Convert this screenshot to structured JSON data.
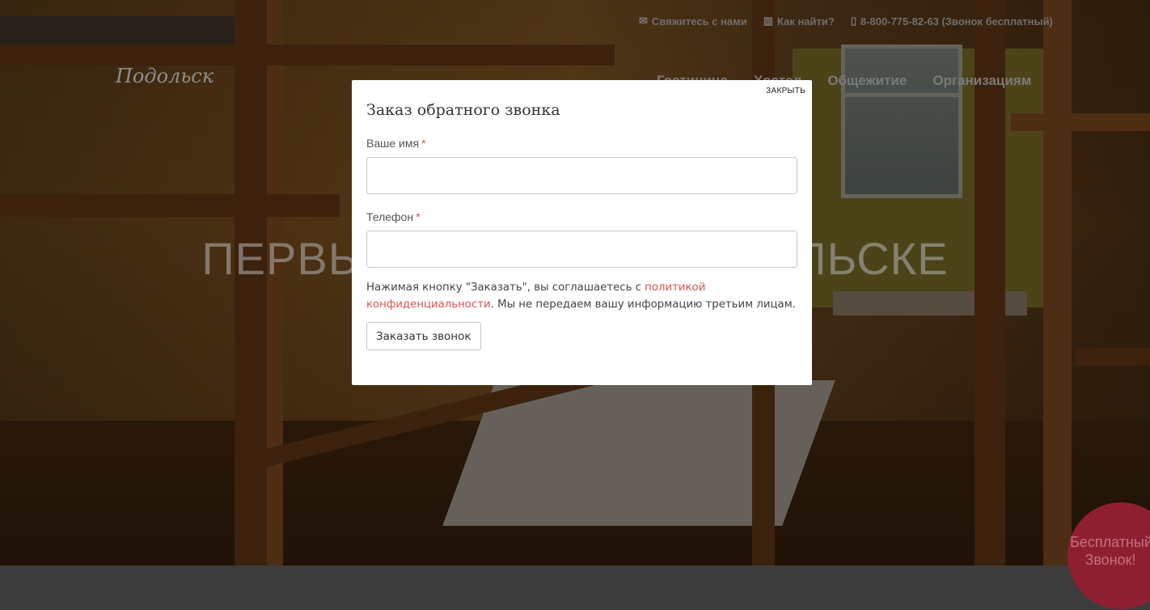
{
  "topbar": {
    "contact_label": "Свяжитесь с нами",
    "find_label": "Как найти?",
    "phone_label": "8-800-775-82-63 (Звонок бесплатный)"
  },
  "logo": "Подольск",
  "nav": {
    "item1": "Гостиница",
    "item2": "Хостел",
    "item3": "Общежитие",
    "item4": "Организациям"
  },
  "hero": {
    "title": "ПЕРВЫЙ ХОСТЕЛ В ПОДОЛЬСКЕ"
  },
  "modal": {
    "close_label": "ЗАКРЫТЬ",
    "title": "Заказ обратного звонка",
    "name_label": "Ваше имя",
    "name_value": "",
    "phone_label": "Телефон",
    "phone_value": "",
    "required_mark": "*",
    "consent_before": "Нажимая кнопку \"Заказать\", вы соглашаетесь с ",
    "consent_link": "политикой конфиденциальности",
    "consent_after": ". Мы не передаем вашу информацию третьим лицам.",
    "submit_label": "Заказать звонок"
  },
  "free_call": {
    "line1": "Бесплатный",
    "line2": "Звонок!"
  },
  "colors": {
    "accent": "#d9534f",
    "free_call_bg": "#8e1f31"
  }
}
